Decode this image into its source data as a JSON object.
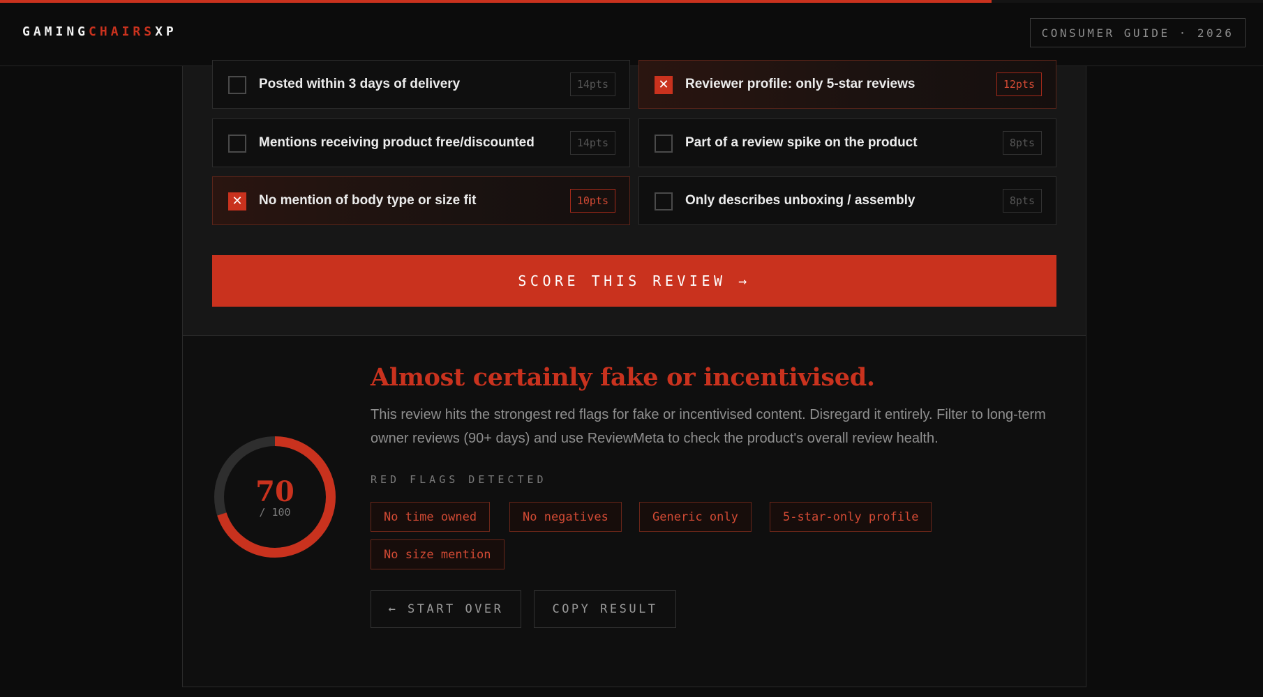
{
  "header": {
    "logo_part1": "GAMING",
    "logo_part2": "CHAIRS",
    "logo_part3": "XP",
    "badge": "CONSUMER GUIDE · 2026",
    "progress_percent": 78.5
  },
  "checklist": [
    {
      "label": "Posted within 3 days of delivery",
      "points": "14pts",
      "checked": false
    },
    {
      "label": "Reviewer profile: only 5-star reviews",
      "points": "12pts",
      "checked": true
    },
    {
      "label": "Mentions receiving product free/discounted",
      "points": "14pts",
      "checked": false
    },
    {
      "label": "Part of a review spike on the product",
      "points": "8pts",
      "checked": false
    },
    {
      "label": "No mention of body type or size fit",
      "points": "10pts",
      "checked": true
    },
    {
      "label": "Only describes unboxing / assembly",
      "points": "8pts",
      "checked": false
    }
  ],
  "check_mark": "✕",
  "score_button": "SCORE THIS REVIEW →",
  "result": {
    "score": "70",
    "score_max": "/ 100",
    "score_fraction": 0.7,
    "title": "Almost certainly fake or incentivised.",
    "body": "This review hits the strongest red flags for fake or incentivised content. Disregard it entirely. Filter to long-term owner reviews (90+ days) and use ReviewMeta to check the product's overall review health.",
    "flags_heading": "RED FLAGS DETECTED",
    "flags": [
      "No time owned",
      "No negatives",
      "Generic only",
      "5-star-only profile",
      "No size mention"
    ],
    "start_over": "← START OVER",
    "copy_result": "COPY RESULT"
  },
  "colors": {
    "accent": "#c9321e",
    "background": "#0c0c0c",
    "panel": "#171717",
    "gauge_track": "#2e2e2e"
  }
}
